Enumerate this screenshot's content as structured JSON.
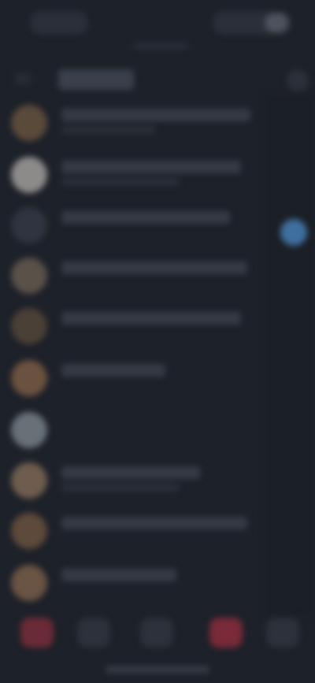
{
  "topbar": {
    "left_label": "",
    "right_label": ""
  },
  "header": {
    "title": ""
  },
  "rows": [
    {
      "avatar_color": "#5a4a3a"
    },
    {
      "avatar_color": "#8d8b89"
    },
    {
      "avatar_color": "#2f3440"
    },
    {
      "avatar_color": "#5a5149"
    },
    {
      "avatar_color": "#4b4036"
    },
    {
      "avatar_color": "#6b5240"
    },
    {
      "avatar_color": "#687078"
    },
    {
      "avatar_color": "#6e5d4e"
    },
    {
      "avatar_color": "#5d4a3a"
    },
    {
      "avatar_color": "#6a5444"
    }
  ],
  "nav": [
    {
      "icon": "home-icon",
      "color": "#6b2b36"
    },
    {
      "icon": "search-icon",
      "color": "#2c313a"
    },
    {
      "icon": "plus-icon",
      "color": "#2c313a"
    },
    {
      "icon": "heart-icon",
      "color": "#7a2a38"
    },
    {
      "icon": "profile-icon",
      "color": "#2c313a"
    }
  ],
  "colors": {
    "background": "#1d2129",
    "accent": "#3f6f9e"
  }
}
